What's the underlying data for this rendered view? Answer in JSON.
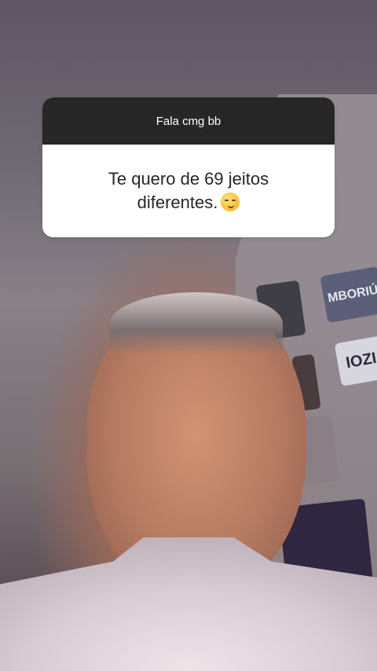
{
  "question_card": {
    "prompt": "Fala cmg bb",
    "answer_text": "Te quero de 69 jeitos diferentes.",
    "answer_emoji": "smirking-face-emoji"
  },
  "background": {
    "plate_text_1": "MBORIÚ",
    "plate_text_2": "IOZI"
  }
}
